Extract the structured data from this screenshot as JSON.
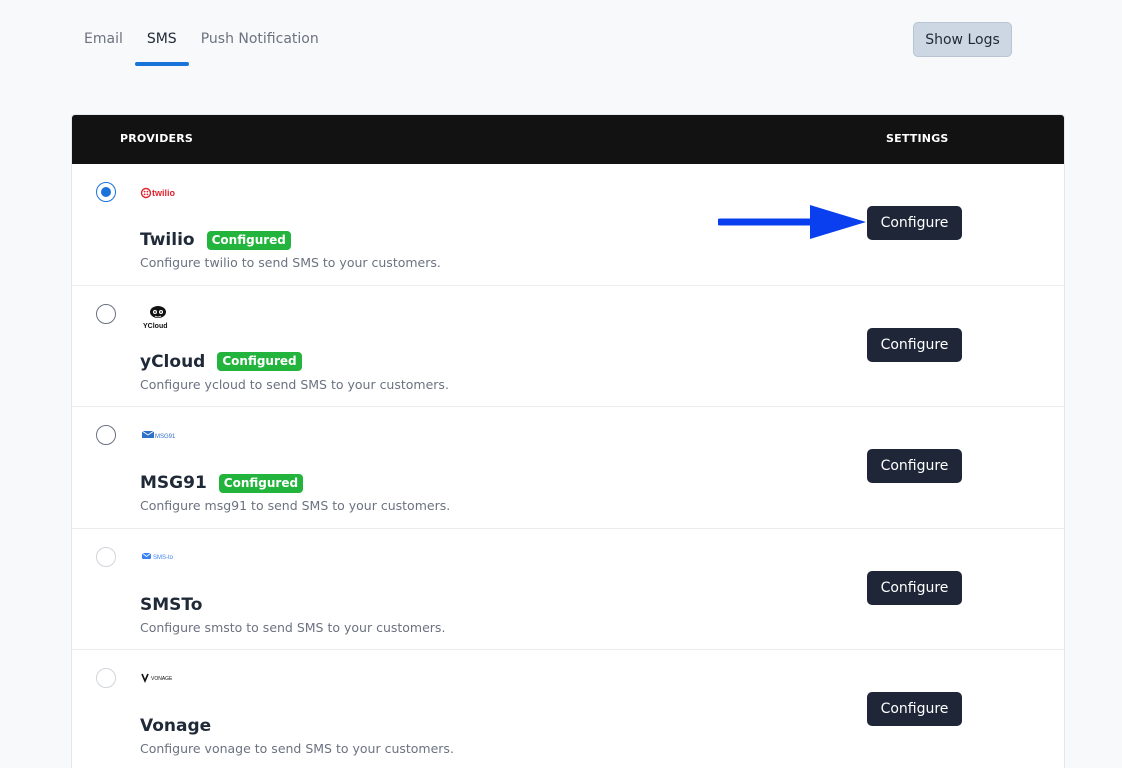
{
  "tabs": [
    {
      "label": "Email",
      "active": false
    },
    {
      "label": "SMS",
      "active": true
    },
    {
      "label": "Push Notification",
      "active": false
    }
  ],
  "show_logs_label": "Show Logs",
  "table": {
    "header_providers": "PROVIDERS",
    "header_settings": "SETTINGS",
    "rows": [
      {
        "logo_text": "twilio",
        "name": "Twilio",
        "badge": "Configured",
        "desc": "Configure twilio to send SMS to your customers.",
        "button": "Configure",
        "selected": true
      },
      {
        "logo_text": "YCloud",
        "name": "yCloud",
        "badge": "Configured",
        "desc": "Configure ycloud to send SMS to your customers.",
        "button": "Configure",
        "selected": false
      },
      {
        "logo_text": "MSG91",
        "name": "MSG91",
        "badge": "Configured",
        "desc": "Configure msg91 to send SMS to your customers.",
        "button": "Configure",
        "selected": false
      },
      {
        "logo_text": "SMS-to",
        "name": "SMSTo",
        "badge": "",
        "desc": "Configure smsto to send SMS to your customers.",
        "button": "Configure",
        "selected": false
      },
      {
        "logo_text": "VONAGE",
        "name": "Vonage",
        "badge": "",
        "desc": "Configure vonage to send SMS to your customers.",
        "button": "Configure",
        "selected": false
      }
    ]
  },
  "colors": {
    "accent": "#1a73d9",
    "header_bg": "#121212",
    "badge_green": "#22b43c",
    "button_dark": "#1f2637",
    "arrow_blue": "#0a3ff0"
  }
}
